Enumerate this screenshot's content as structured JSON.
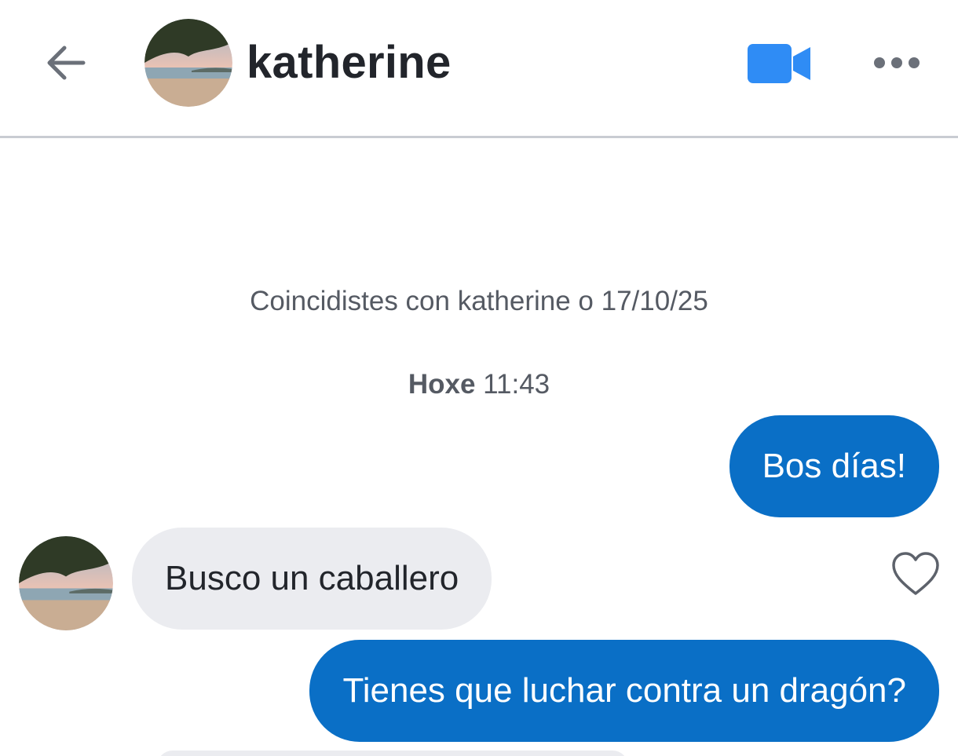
{
  "header": {
    "contact_name": "katherine",
    "back_icon": "arrow-left-icon",
    "video_icon": "video-camera-icon",
    "more_icon": "more-dots-icon",
    "accent_color": "#2f8cf5"
  },
  "chat": {
    "match_notice": "Coincidistes con katherine o 17/10/25",
    "timestamp_day": "Hoxe",
    "timestamp_time": "11:43",
    "messages": [
      {
        "direction": "outgoing",
        "text": "Bos días!"
      },
      {
        "direction": "incoming",
        "text": "Busco un caballero"
      },
      {
        "direction": "outgoing",
        "text": "Tienes que luchar contra un dragón?"
      }
    ],
    "like_icon": "heart-outline-icon",
    "outgoing_color": "#0a6fc6",
    "incoming_color": "#ebecf0"
  }
}
